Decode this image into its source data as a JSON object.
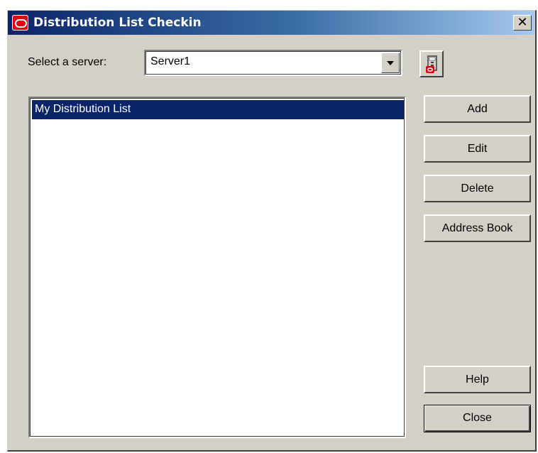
{
  "window": {
    "title": "Distribution List Checkin",
    "close_glyph": "✕"
  },
  "server": {
    "label": "Select a server:",
    "selected": "Server1",
    "icon": "server-config-icon"
  },
  "list": {
    "items": [
      "My Distribution List"
    ],
    "selected_index": 0
  },
  "buttons": {
    "add": "Add",
    "edit": "Edit",
    "delete": "Delete",
    "address_book": "Address Book",
    "help": "Help",
    "close": "Close"
  },
  "colors": {
    "titlebar_start": "#0a246a",
    "titlebar_end": "#a6caf0",
    "selection": "#0a246a",
    "window_face": "#d4d0c8",
    "app_icon_red": "#e3000f"
  }
}
